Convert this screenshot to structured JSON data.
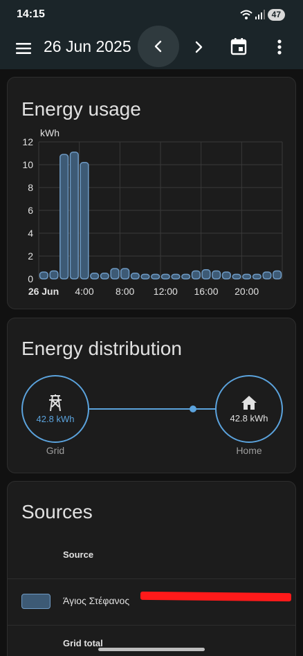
{
  "status_bar": {
    "time": "14:15",
    "battery": "47"
  },
  "app_bar": {
    "date": "26 Jun 2025"
  },
  "energy_usage": {
    "title": "Energy usage",
    "unit": "kWh",
    "bar_color": "#3d5a75",
    "bar_stroke": "#6f9bc5",
    "chart_data": {
      "type": "bar",
      "ylabel": "kWh",
      "ylim": [
        0,
        12
      ],
      "y_ticks": [
        "0",
        "2",
        "4",
        "6",
        "8",
        "10",
        "12"
      ],
      "x_tick_labels": [
        "26 Jun",
        "4:00",
        "8:00",
        "12:00",
        "16:00",
        "20:00"
      ],
      "categories": [
        "0:00",
        "1:00",
        "2:00",
        "3:00",
        "4:00",
        "5:00",
        "6:00",
        "7:00",
        "8:00",
        "9:00",
        "10:00",
        "11:00",
        "12:00",
        "13:00",
        "14:00",
        "15:00",
        "16:00",
        "17:00",
        "18:00",
        "19:00",
        "20:00",
        "21:00",
        "22:00",
        "23:00"
      ],
      "values": [
        0.6,
        0.7,
        10.9,
        11.1,
        10.2,
        0.5,
        0.5,
        0.9,
        0.9,
        0.5,
        0.4,
        0.4,
        0.4,
        0.4,
        0.4,
        0.7,
        0.8,
        0.7,
        0.6,
        0.4,
        0.4,
        0.4,
        0.6,
        0.7
      ],
      "grid": true
    }
  },
  "energy_distribution": {
    "title": "Energy distribution",
    "grid": {
      "value": "42.8 kWh",
      "label": "Grid"
    },
    "home": {
      "value": "42.8 kWh",
      "label": "Home"
    },
    "accent": "#5ba3dd"
  },
  "sources": {
    "title": "Sources",
    "column_header": "Source",
    "rows": [
      {
        "name": "Άγιος Στέφανος"
      }
    ],
    "total_label": "Grid total"
  }
}
